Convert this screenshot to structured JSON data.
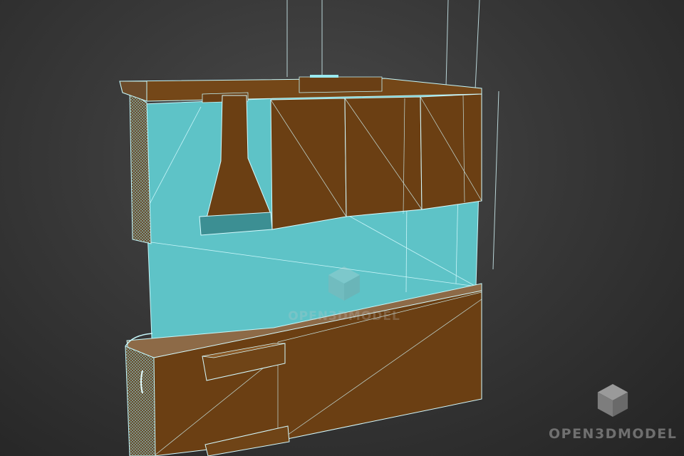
{
  "scene": {
    "description_label": "3D wireframe model viewport",
    "colors": {
      "background_center": "#4a4a4a",
      "background_edge": "#242424",
      "wood": "#6b4117",
      "wood_dark": "#4e2e0e",
      "glass": "#5fc4c8",
      "wire": "#bff4f8"
    }
  },
  "watermarks": {
    "center_text": "OPEN3DMODEL",
    "corner_text": "OPEN3DMODEL",
    "icon": "cube-logo-icon"
  }
}
